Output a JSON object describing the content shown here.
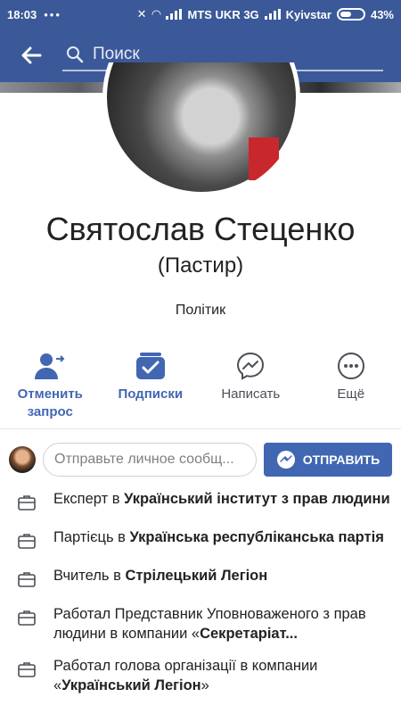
{
  "status_bar": {
    "time": "18:03",
    "carrier1": "MTS UKR 3G",
    "carrier2": "Kyivstar",
    "battery": "43%"
  },
  "search": {
    "placeholder": "Поиск"
  },
  "profile": {
    "name": "Святослав Стеценко",
    "nickname": "(Пастир)",
    "job": "Політик"
  },
  "actions": [
    {
      "label_line1": "Отменить",
      "label_line2": "запрос",
      "icon": "user-request-icon"
    },
    {
      "label_line1": "Подписки",
      "label_line2": "",
      "icon": "subscriptions-icon"
    },
    {
      "label_line1": "Написать",
      "label_line2": "",
      "icon": "messenger-icon"
    },
    {
      "label_line1": "Ещё",
      "label_line2": "",
      "icon": "more-icon"
    }
  ],
  "message": {
    "placeholder": "Отправьте личное сообщ...",
    "send_label": "ОТПРАВИТЬ"
  },
  "info": [
    {
      "prefix": "Експерт в ",
      "bold": "Український інститут з прав людини",
      "suffix": ""
    },
    {
      "prefix": "Партієць в ",
      "bold": "Українська республіканська партія",
      "suffix": ""
    },
    {
      "prefix": "Вчитель в ",
      "bold": "Стрілецький Легіон",
      "suffix": ""
    },
    {
      "prefix": "Работал Представник Уповноваженого з прав людини в компании «",
      "bold": "Секретаріат...",
      "suffix": ""
    },
    {
      "prefix": "Работал голова організації в компании «",
      "bold": "Український Легіон",
      "suffix": "»"
    }
  ],
  "colors": {
    "brand": "#3b5998",
    "accent": "#4267b2"
  }
}
